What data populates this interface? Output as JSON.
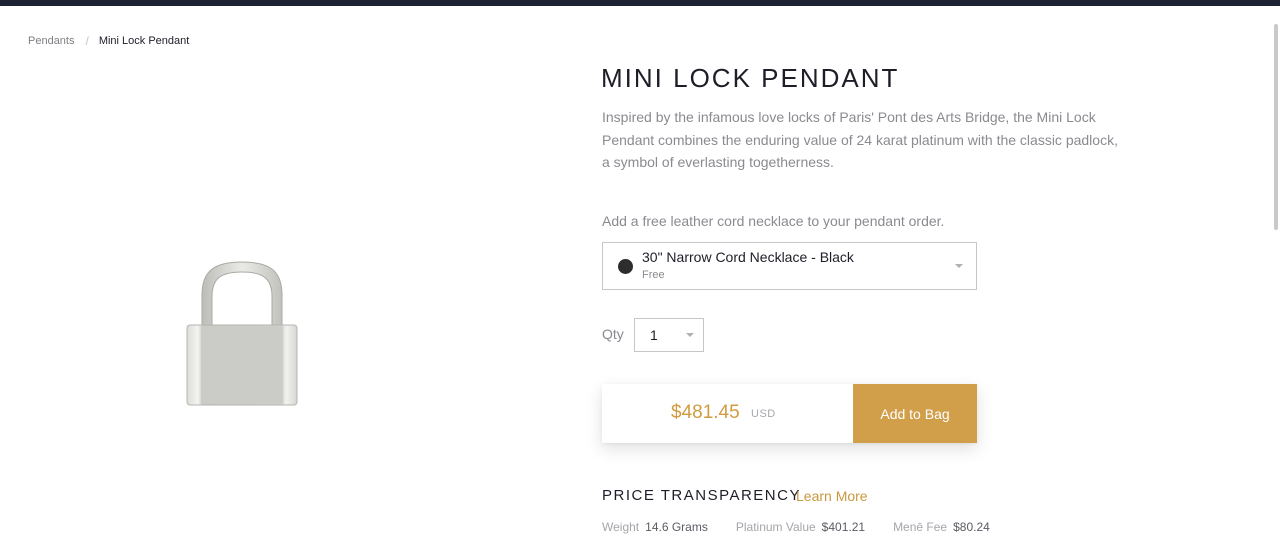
{
  "breadcrumb": {
    "parent": "Pendants",
    "separator": "/",
    "current": "Mini Lock Pendant"
  },
  "product": {
    "title": "MINI LOCK PENDANT",
    "description": "Inspired by the infamous love locks of Paris' Pont des Arts Bridge, the Mini Lock Pendant combines the enduring value of 24 karat platinum with the classic padlock, a symbol of everlasting togetherness.",
    "image_icon": "padlock-pendant"
  },
  "cord": {
    "prompt": "Add a free leather cord necklace to your pendant order.",
    "selected_name": "30\" Narrow Cord Necklace - Black",
    "selected_price": "Free",
    "swatch_color": "#2d2d2d"
  },
  "quantity": {
    "label": "Qty",
    "value": "1"
  },
  "purchase": {
    "price": "$481.45",
    "currency": "USD",
    "add_button": "Add to Bag",
    "accent_color": "#d19e4a"
  },
  "transparency": {
    "title": "PRICE TRANSPARENCY",
    "learn_more": "Learn More",
    "stats": [
      {
        "label": "Weight",
        "value": "14.6 Grams"
      },
      {
        "label": "Platinum Value",
        "value": "$401.21"
      },
      {
        "label": "Menē Fee",
        "value": "$80.24"
      }
    ]
  }
}
